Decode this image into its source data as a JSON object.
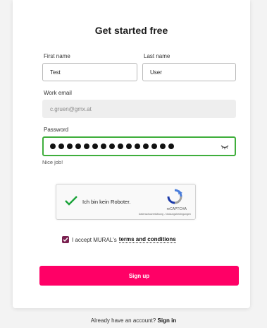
{
  "form": {
    "title": "Get started free",
    "first_name_label": "First name",
    "first_name_value": "Test",
    "last_name_label": "Last name",
    "last_name_value": "User",
    "work_email_label": "Work email",
    "work_email_value": "c.gruen@gmx.at",
    "password_label": "Password",
    "password_mask_count": 15,
    "password_hint": "Nice job!",
    "terms_prefix": "I accept MURAL's",
    "terms_link": "terms and conditions",
    "signup_label": "Sign up"
  },
  "captcha": {
    "label": "Ich bin kein Roboter.",
    "brand": "reCAPTCHA",
    "legal": "Datenschutzerklärung - Nutzungsbedingungen",
    "checked": true
  },
  "footer": {
    "prompt": "Already have an account?",
    "signin": "Sign in"
  },
  "colors": {
    "accent": "#ff0066",
    "valid": "#3fae3c",
    "checkbox": "#7a2150"
  },
  "icons": [
    "eye-icon",
    "captcha-check-icon",
    "recaptcha-logo-icon",
    "checkbox-checked-icon"
  ]
}
